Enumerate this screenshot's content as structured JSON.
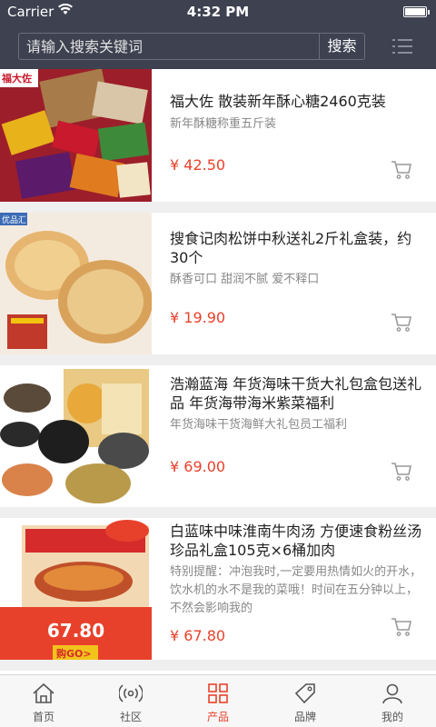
{
  "status_bar": {
    "carrier": "Carrier",
    "time": "4:32 PM"
  },
  "search": {
    "placeholder": "请输入搜索关键词",
    "button": "搜索"
  },
  "products": [
    {
      "title": "福大佐 散装新年酥心糖2460克装",
      "subtitle": "新年酥糖称重五斤装",
      "price": "¥ 42.50",
      "thumb_text": "福大佐"
    },
    {
      "title": "搜食记肉松饼中秋送礼2斤礼盒装，约30个",
      "subtitle": "酥香可口 甜润不腻 爱不释口",
      "price": "¥ 19.90",
      "thumb_text": "优品汇"
    },
    {
      "title": "浩瀚蓝海 年货海味干货大礼包盒包送礼品 年货海带海米紫菜福利",
      "subtitle": "年货海味干货海鲜大礼包员工福利",
      "price": "¥ 69.00"
    },
    {
      "title": "白蓝味中味淮南牛肉汤 方便速食粉丝汤 珍品礼盒105克×6桶加肉",
      "subtitle": "特别提醒：冲泡我时,一定要用热情如火的开水，饮水机的水不是我的菜哦！时间在五分钟以上，不然会影响我的",
      "price": "¥ 67.80",
      "thumb_price": "67.80",
      "thumb_badge": "购GO>"
    }
  ],
  "tabs": [
    {
      "label": "首页",
      "icon": "home-icon"
    },
    {
      "label": "社区",
      "icon": "broadcast-icon"
    },
    {
      "label": "产品",
      "icon": "grid-icon",
      "active": true
    },
    {
      "label": "品牌",
      "icon": "tag-icon"
    },
    {
      "label": "我的",
      "icon": "user-icon"
    }
  ],
  "colors": {
    "header": "#3d4150",
    "accent": "#e8412b",
    "background": "#efefef"
  }
}
